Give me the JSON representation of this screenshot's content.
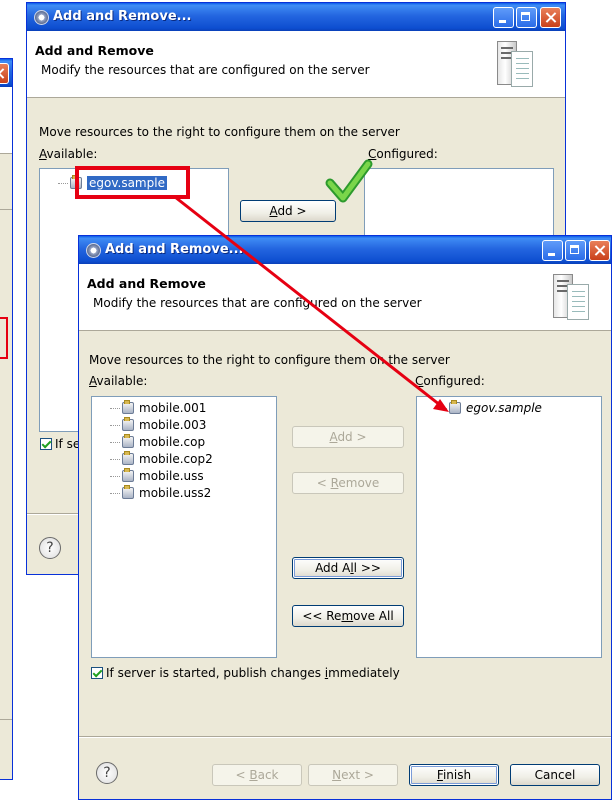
{
  "dialog": {
    "title": "Add and Remove...",
    "header_title": "Add and Remove",
    "header_desc": "Modify the resources that are configured on the server",
    "instruction": "Move resources to the right to configure them on the server",
    "available_label": "Available:",
    "configured_label": "Configured:",
    "add_label": "Add >",
    "remove_label": "< Remove",
    "add_all_label": "Add All >>",
    "remove_all_label": "<< Remove All",
    "publish_checkbox_label": "If server is started, publish changes immediately",
    "publish_checked": true,
    "help_symbol": "?",
    "back_label": "< Back",
    "next_label": "Next >",
    "finish_label": "Finish",
    "cancel_label": "Cancel"
  },
  "back_dialog": {
    "available_items": [
      "egov.sample"
    ],
    "configured_items": [],
    "partial_checkbox_label": "If se"
  },
  "front_dialog": {
    "available_items": [
      "mobile.001",
      "mobile.003",
      "mobile.cop",
      "mobile.cop2",
      "mobile.uss",
      "mobile.uss2"
    ],
    "configured_items": [
      "egov.sample"
    ]
  },
  "annotation": {
    "highlight_color": "#e60012",
    "check_color": "#3bb33b"
  }
}
